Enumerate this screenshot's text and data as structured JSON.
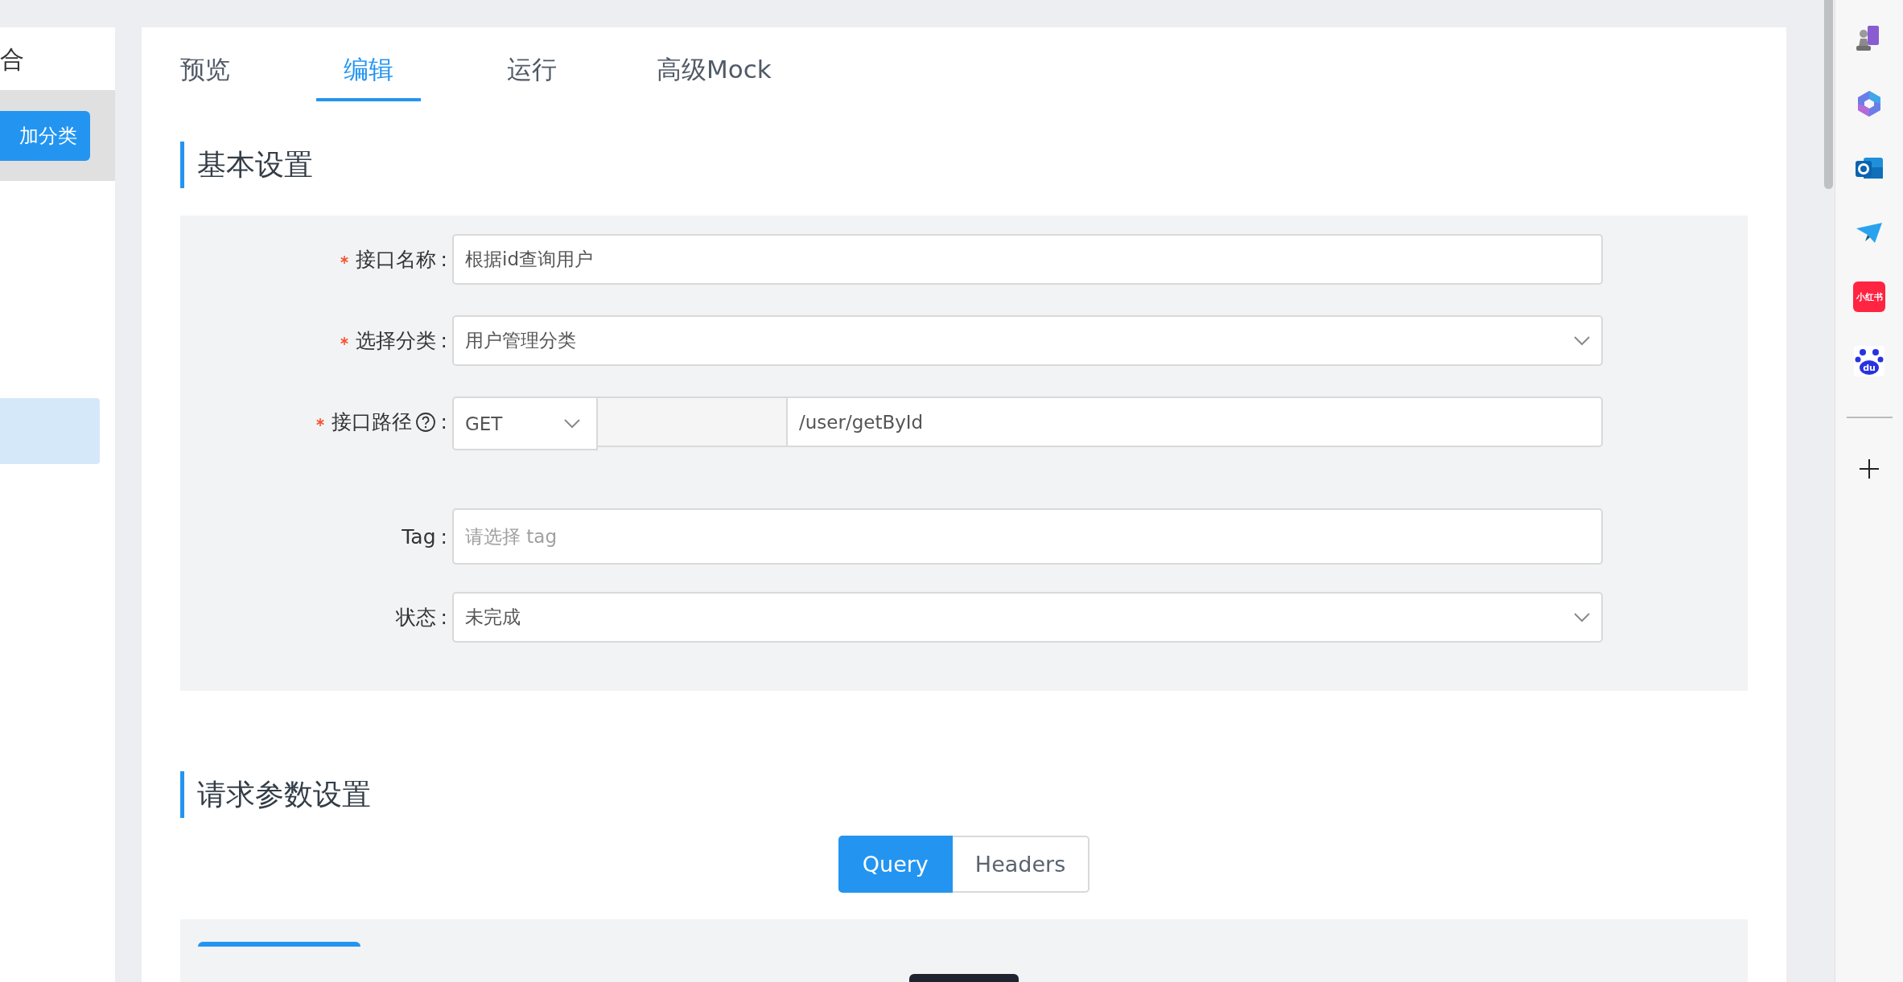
{
  "left_panel": {
    "title": "合",
    "add_button": "加分类",
    "items": [
      {
        "selected": true
      }
    ]
  },
  "tabs": [
    {
      "label": "预览",
      "selected": false
    },
    {
      "label": "编辑",
      "selected": true
    },
    {
      "label": "运行",
      "selected": false
    },
    {
      "label": "高级Mock",
      "selected": false
    }
  ],
  "basic_settings": {
    "heading": "基本设置",
    "fields": [
      {
        "kind": "input",
        "label": "接口名称",
        "colon": ":",
        "required": true,
        "value": "根据id查询用户"
      },
      {
        "kind": "select",
        "label": "选择分类",
        "colon": ":",
        "required": true,
        "value": "用户管理分类"
      },
      {
        "kind": "path",
        "label": "接口路径",
        "colon": ":",
        "required": true,
        "help": true,
        "method": "GET",
        "value": "/user/getById"
      },
      {
        "kind": "input",
        "label": "Tag",
        "colon": ":",
        "required": false,
        "placeholder": "请选择 tag"
      },
      {
        "kind": "select",
        "label": "状态",
        "colon": ":",
        "required": false,
        "value": "未完成"
      }
    ]
  },
  "request_settings": {
    "heading": "请求参数设置",
    "segments": [
      {
        "label": "Query",
        "selected": true
      },
      {
        "label": "Headers",
        "selected": false
      }
    ]
  },
  "side_bar": {
    "apps": [
      {
        "kind": "chess"
      },
      {
        "kind": "hexagon"
      },
      {
        "kind": "mail"
      },
      {
        "kind": "plane"
      },
      {
        "kind": "note",
        "label": "小红书"
      },
      {
        "kind": "paw",
        "label": "du"
      }
    ]
  }
}
